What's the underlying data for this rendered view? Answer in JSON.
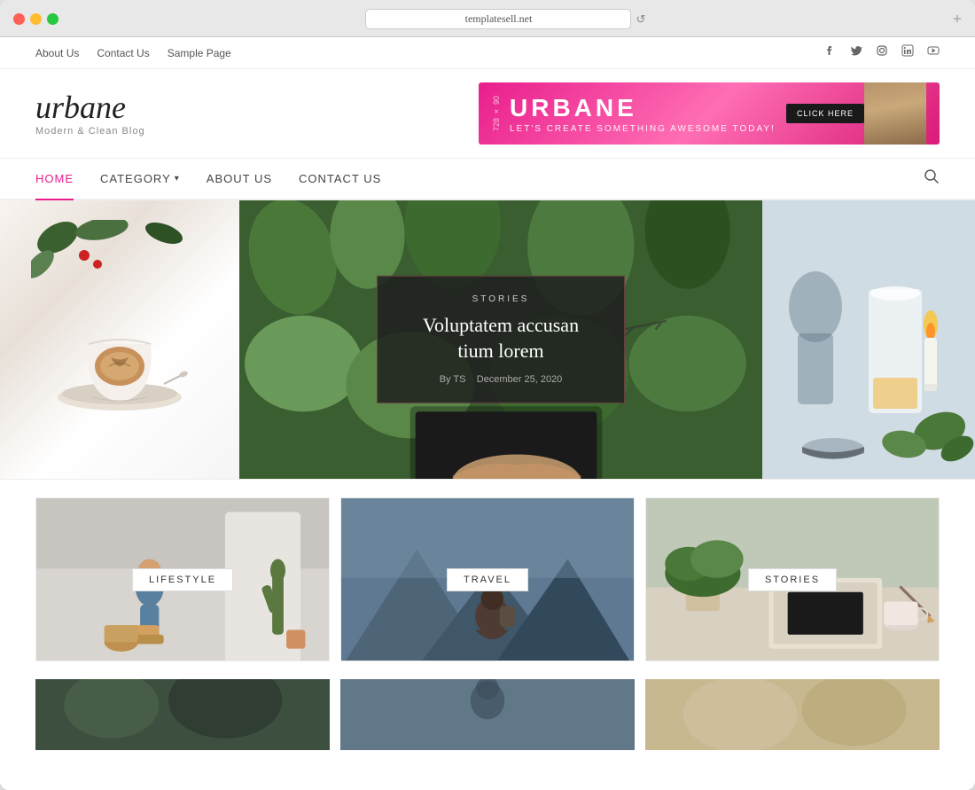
{
  "browser": {
    "url": "templatesell.net",
    "add_button": "+",
    "reload_icon": "↺"
  },
  "top_bar": {
    "links": [
      {
        "label": "About Us",
        "href": "#"
      },
      {
        "label": "Contact Us",
        "href": "#"
      },
      {
        "label": "Sample Page",
        "href": "#"
      }
    ],
    "social": [
      {
        "name": "facebook",
        "icon": "f"
      },
      {
        "name": "twitter",
        "icon": "t"
      },
      {
        "name": "instagram",
        "icon": "i"
      },
      {
        "name": "linkedin",
        "icon": "in"
      },
      {
        "name": "youtube",
        "icon": "▶"
      }
    ]
  },
  "logo": {
    "name": "urbane",
    "tagline": "Modern & Clean Blog"
  },
  "banner": {
    "size": "728 × 90",
    "brand": "URBANE",
    "tagline": "LET'S CREATE SOMETHING AWESOME TODAY!",
    "cta": "CLICK HERE"
  },
  "nav": {
    "items": [
      {
        "label": "HOME",
        "active": true
      },
      {
        "label": "CATEGORY",
        "has_dropdown": true
      },
      {
        "label": "ABOUT US"
      },
      {
        "label": "CONTACT US"
      }
    ],
    "search_placeholder": "Search..."
  },
  "featured_post": {
    "category": "STORIES",
    "title": "Voluptatem accusan tium lorem",
    "author": "TS",
    "date": "December 25, 2020",
    "by_label": "By"
  },
  "category_cards": [
    {
      "label": "LIFESTYLE"
    },
    {
      "label": "TRAVEL"
    },
    {
      "label": "STORIES"
    }
  ]
}
